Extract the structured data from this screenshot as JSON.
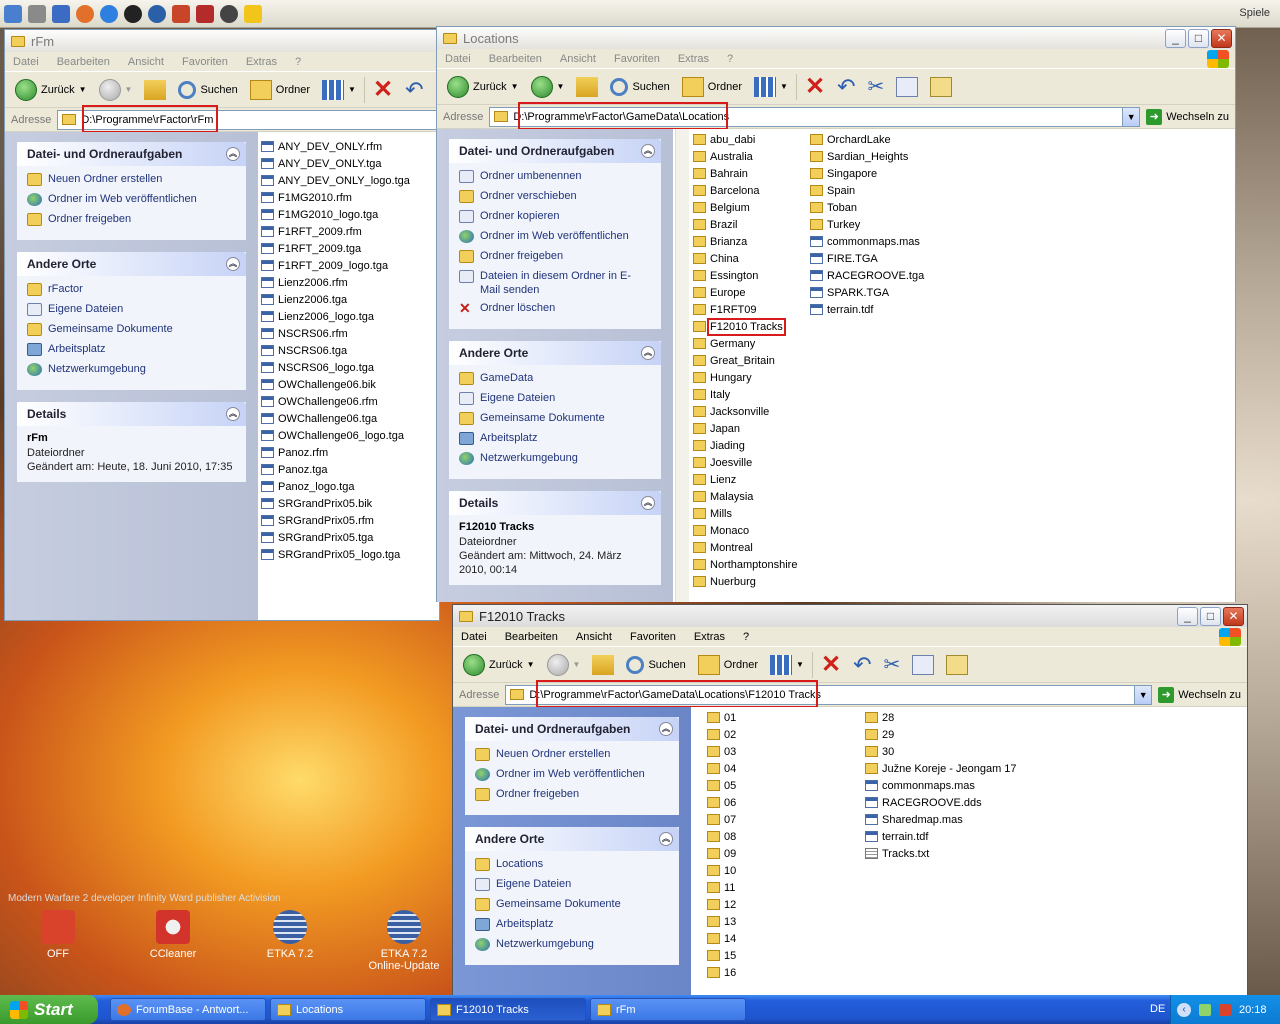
{
  "desktop": {
    "wallpaper_caption": "Modern Warfare 2 developer Infinity Ward publisher Activision",
    "icons": [
      {
        "label": "OFF"
      },
      {
        "label": "CCleaner"
      },
      {
        "label": "ETKA 7.2"
      },
      {
        "label": "ETKA 7.2 Online-Update"
      }
    ],
    "spiele": "Spiele"
  },
  "menu": {
    "datei": "Datei",
    "bearbeiten": "Bearbeiten",
    "ansicht": "Ansicht",
    "favoriten": "Favoriten",
    "extras": "Extras",
    "help": "?"
  },
  "toolbar": {
    "back": "Zurück",
    "search": "Suchen",
    "folders": "Ordner"
  },
  "address_label": "Adresse",
  "goto_label": "Wechseln zu",
  "windows": {
    "rfm": {
      "title": "rFm",
      "address": "D:\\Programme\\rFactor\\rFm",
      "tasks_header": "Datei- und Ordneraufgaben",
      "tasks": [
        "Neuen Ordner erstellen",
        "Ordner im Web veröffentlichen",
        "Ordner freigeben"
      ],
      "places_header": "Andere Orte",
      "places": [
        "rFactor",
        "Eigene Dateien",
        "Gemeinsame Dokumente",
        "Arbeitsplatz",
        "Netzwerkumgebung"
      ],
      "details_header": "Details",
      "details_name": "rFm",
      "details_type": "Dateiordner",
      "details_modified": "Geändert am: Heute, 18. Juni 2010, 17:35",
      "files": [
        "ANY_DEV_ONLY.rfm",
        "ANY_DEV_ONLY.tga",
        "ANY_DEV_ONLY_logo.tga",
        "F1MG2010.rfm",
        "F1MG2010_logo.tga",
        "F1RFT_2009.rfm",
        "F1RFT_2009.tga",
        "F1RFT_2009_logo.tga",
        "Lienz2006.rfm",
        "Lienz2006.tga",
        "Lienz2006_logo.tga",
        "NSCRS06.rfm",
        "NSCRS06.tga",
        "NSCRS06_logo.tga",
        "OWChallenge06.bik",
        "OWChallenge06.rfm",
        "OWChallenge06.tga",
        "OWChallenge06_logo.tga",
        "Panoz.rfm",
        "Panoz.tga",
        "Panoz_logo.tga",
        "SRGrandPrix05.bik",
        "SRGrandPrix05.rfm",
        "SRGrandPrix05.tga",
        "SRGrandPrix05_logo.tga"
      ]
    },
    "locations": {
      "title": "Locations",
      "address": "D:\\Programme\\rFactor\\GameData\\Locations",
      "tasks_header": "Datei- und Ordneraufgaben",
      "tasks": [
        "Ordner umbenennen",
        "Ordner verschieben",
        "Ordner kopieren",
        "Ordner im Web veröffentlichen",
        "Ordner freigeben",
        "Dateien in diesem Ordner in E-Mail senden",
        "Ordner löschen"
      ],
      "places_header": "Andere Orte",
      "places": [
        "GameData",
        "Eigene Dateien",
        "Gemeinsame Dokumente",
        "Arbeitsplatz",
        "Netzwerkumgebung"
      ],
      "details_header": "Details",
      "details_name": "F12010 Tracks",
      "details_type": "Dateiordner",
      "details_modified": "Geändert am: Mittwoch, 24. März 2010, 00:14",
      "col1": [
        "abu_dabi",
        "Australia",
        "Bahrain",
        "Barcelona",
        "Belgium",
        "Brazil",
        "Brianza",
        "China",
        "Essington",
        "Europe",
        "F1RFT09",
        "F12010 Tracks",
        "Germany",
        "Great_Britain",
        "Hungary",
        "Italy",
        "Jacksonville",
        "Japan",
        "Jiading",
        "Joesville",
        "Lienz",
        "Malaysia",
        "Mills",
        "Monaco",
        "Montreal",
        "Northamptonshire",
        "Nuerburg"
      ],
      "col2_folders": [
        "OrchardLake",
        "Sardian_Heights",
        "Singapore",
        "Spain",
        "Toban",
        "Turkey"
      ],
      "col2_files": [
        "commonmaps.mas",
        "FIRE.TGA",
        "RACEGROOVE.tga",
        "SPARK.TGA",
        "terrain.tdf"
      ]
    },
    "tracks": {
      "title": "F12010 Tracks",
      "address": "D:\\Programme\\rFactor\\GameData\\Locations\\F12010 Tracks",
      "tasks_header": "Datei- und Ordneraufgaben",
      "tasks": [
        "Neuen Ordner erstellen",
        "Ordner im Web veröffentlichen",
        "Ordner freigeben"
      ],
      "places_header": "Andere Orte",
      "places": [
        "Locations",
        "Eigene Dateien",
        "Gemeinsame Dokumente",
        "Arbeitsplatz",
        "Netzwerkumgebung"
      ],
      "col1": [
        "01",
        "02",
        "03",
        "04",
        "05",
        "06",
        "07",
        "08",
        "09",
        "10",
        "11",
        "12",
        "13",
        "14",
        "15",
        "16"
      ],
      "col2_folders": [
        "28",
        "29",
        "30",
        "Južne Koreje - Jeongam 17"
      ],
      "col2_files": [
        "commonmaps.mas",
        "RACEGROOVE.dds",
        "Sharedmap.mas",
        "terrain.tdf",
        "Tracks.txt"
      ]
    }
  },
  "taskbar": {
    "start": "Start",
    "tasks": [
      "ForumBase - Antwort...",
      "Locations",
      "F12010 Tracks",
      "rFm"
    ],
    "lang": "DE",
    "clock": "20:18"
  }
}
